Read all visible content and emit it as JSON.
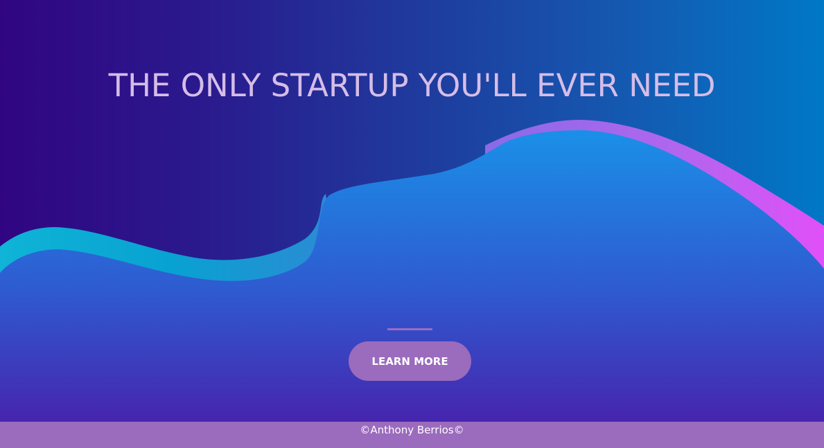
{
  "hero": {
    "headline": "THE ONLY STARTUP YOU'LL EVER NEED",
    "cta_label": "LEARN MORE"
  },
  "footer": {
    "copyright": "©Anthony Berrios©"
  },
  "colors": {
    "headline": "#d6bde8",
    "cta_background": "#9b6bbd",
    "footer_background": "#9b6bbd",
    "wave_cyan": "#0aa6d6",
    "wave_magenta": "#d655f5",
    "wave_blue_top": "#1a8ee6",
    "wave_blue_bottom": "#4628b0"
  }
}
